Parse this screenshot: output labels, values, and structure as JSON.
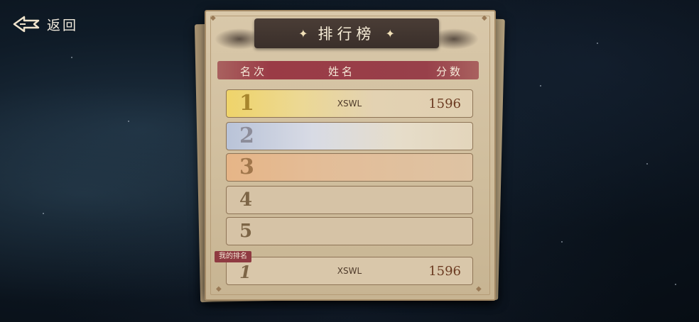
{
  "nav": {
    "back_label": "返回"
  },
  "leaderboard": {
    "title": "排行榜",
    "columns": {
      "rank": "名次",
      "name": "姓名",
      "score": "分数"
    },
    "rows": [
      {
        "rank": "1",
        "name": "XSWL",
        "score": "1596"
      },
      {
        "rank": "2",
        "name": "",
        "score": ""
      },
      {
        "rank": "3",
        "name": "",
        "score": ""
      },
      {
        "rank": "4",
        "name": "",
        "score": ""
      },
      {
        "rank": "5",
        "name": "",
        "score": ""
      }
    ],
    "my_rank": {
      "tag": "我的排名",
      "rank": "1",
      "name": "XSWL",
      "score": "1596"
    }
  }
}
